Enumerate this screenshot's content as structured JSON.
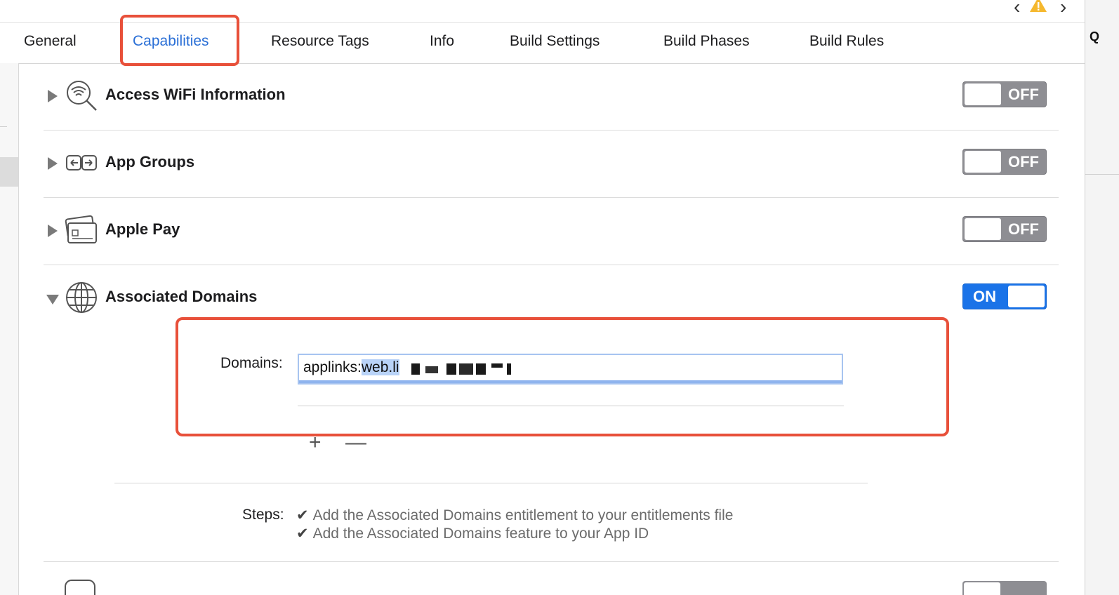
{
  "tabs": [
    {
      "label": "General"
    },
    {
      "label": "Capabilities"
    },
    {
      "label": "Resource Tags"
    },
    {
      "label": "Info"
    },
    {
      "label": "Build Settings"
    },
    {
      "label": "Build Phases"
    },
    {
      "label": "Build Rules"
    }
  ],
  "active_tab": "Capabilities",
  "right_panel": {
    "partial_label": "Q"
  },
  "capabilities": [
    {
      "title": "Access WiFi Information",
      "toggle": "OFF",
      "icon": "wifi-search-icon",
      "expanded": false
    },
    {
      "title": "App Groups",
      "toggle": "OFF",
      "icon": "app-groups-icon",
      "expanded": false
    },
    {
      "title": "Apple Pay",
      "toggle": "OFF",
      "icon": "apple-pay-icon",
      "expanded": false
    },
    {
      "title": "Associated Domains",
      "toggle": "ON",
      "icon": "globe-icon",
      "expanded": true
    }
  ],
  "associated_domains": {
    "domains_label": "Domains:",
    "domain_prefix": "applinks:",
    "domain_visible": "web.li",
    "add_label": "+",
    "remove_label": "—",
    "steps_label": "Steps:",
    "steps": [
      "Add the Associated Domains entitlement to your entitlements file",
      "Add the Associated Domains feature to your App ID"
    ]
  },
  "colors": {
    "accent": "#2a6fd6",
    "toggle_on": "#1a73e8",
    "toggle_off": "#8e8e93",
    "highlight": "#e8503a",
    "warning": "#f5b82e"
  }
}
